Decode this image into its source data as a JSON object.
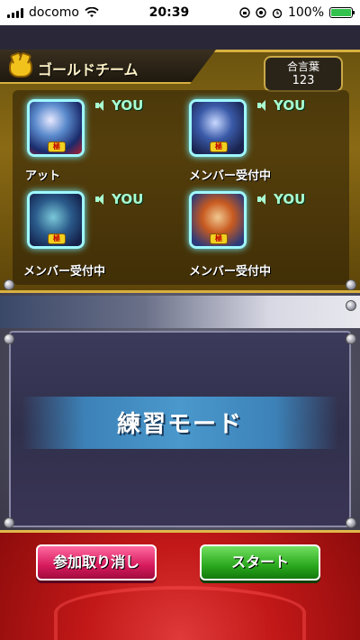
{
  "status_bar": {
    "carrier": "docomo",
    "time": "20:39",
    "battery": "100%"
  },
  "team": {
    "name": "ゴールドチーム",
    "password_label": "合言葉",
    "password_value": "123"
  },
  "slots": [
    {
      "name": "アット",
      "voice": "YOU"
    },
    {
      "name": "メンバー受付中",
      "voice": "YOU"
    },
    {
      "name": "メンバー受付中",
      "voice": "YOU"
    },
    {
      "name": "メンバー受付中",
      "voice": "YOU"
    }
  ],
  "mode": {
    "title": "練習モード"
  },
  "buttons": {
    "cancel": "参加取り消し",
    "start": "スタート"
  },
  "colors": {
    "team_panel": "#8a6a14",
    "voice_label": "#a8ffd2",
    "cancel_button": "#d61a5c",
    "start_button": "#2aa81e",
    "bottom_bar": "#c21818"
  }
}
